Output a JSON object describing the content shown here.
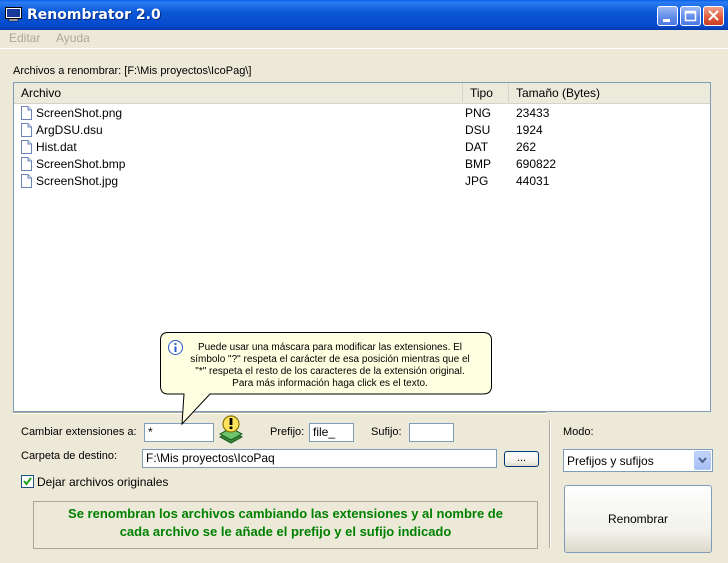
{
  "window": {
    "title": "Renombrator 2.0",
    "accent_color": "#0a5fe9",
    "buttons": [
      "minimize-icon",
      "maximize-icon",
      "close-icon"
    ]
  },
  "menu": {
    "items": [
      {
        "label": "Editar"
      },
      {
        "label": "Ayuda"
      }
    ]
  },
  "files_label": "Archivos a renombrar: [F:\\Mis proyectos\\IcoPag\\]",
  "file_list": {
    "columns": [
      "Archivo",
      "Tipo",
      "Tamaño (Bytes)"
    ],
    "rows": [
      {
        "name": "ScreenShot.png",
        "type": "PNG",
        "size": "23433"
      },
      {
        "name": "ArgDSU.dsu",
        "type": "DSU",
        "size": "1924"
      },
      {
        "name": "Hist.dat",
        "type": "DAT",
        "size": "262"
      },
      {
        "name": "ScreenShot.bmp",
        "type": "BMP",
        "size": "690822"
      },
      {
        "name": "ScreenShot.jpg",
        "type": "JPG",
        "size": "44031"
      }
    ]
  },
  "tooltip": {
    "lines": [
      "Puede usar una máscara para modificar las extensiones. El",
      "símbolo \"?\" respeta el carácter de esa posición mientras que el",
      "\"*\" respeta el resto de los caracteres de la extensión original.",
      "Para más información haga click es el texto."
    ]
  },
  "form": {
    "ext_label": "Cambiar extensiones a:",
    "ext_value": "*",
    "prefix_label": "Prefijo:",
    "prefix_value": "file_",
    "suffix_label": "Sufijo:",
    "suffix_value": "",
    "dest_label": "Carpeta de destino:",
    "dest_value": "F:\\Mis proyectos\\IcoPaq",
    "browse_label": "...",
    "keep_label": "Dejar archivos originales",
    "keep_checked": true,
    "info_lines": [
      "Se renombran los archivos cambiando las extensiones y al nombre de",
      "cada archivo se le añade el prefijo y el sufijo indicado"
    ],
    "info_color": "#008000"
  },
  "mode": {
    "label": "Modo:",
    "selected": "Prefijos y sufijos"
  },
  "rename_button": "Renombrar"
}
